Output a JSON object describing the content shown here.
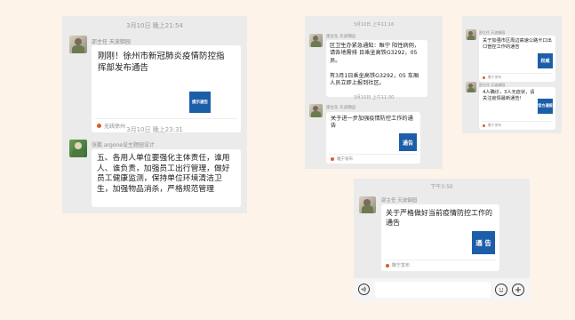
{
  "panel1": {
    "timestamp1": "3月10日 晚上21:54",
    "msg1": {
      "sender": "邵主任 天波御园",
      "text": "刚刚！徐州市新冠肺炎疫情防控指挥部发布通告",
      "thumb_text": "提示通告",
      "source": "无线徐州"
    },
    "timestamp2": "3月10日 晚上23:31",
    "msg2": {
      "sender": "张鹏 argone设主题园设计",
      "text": "五、各用人单位要强化主体责任，谁用人、谁负责，加强员工出行管理，做好员工健康监测，保持单位环境清洁卫生，加强物品消杀，严格规范管理"
    }
  },
  "panel2": {
    "timestamp1": "3月10日 上午11:16",
    "msg1": {
      "sender": "邵主任 天波御园",
      "text1": "区卫生办紧急通知：睢宁 阳性病例，请各地需排 日乘坐高铁G3292，05 员。",
      "text2": "有3月1日乘坐高铁G3292，05 车厢人员立即上报到社区。"
    },
    "timestamp2": "3月10日 上午11:30",
    "msg2": {
      "sender": "邵主任 天波御园",
      "text": "关于进一步加强疫情防控工作的通告",
      "thumb_text": "通告",
      "source": "睢宁发布"
    }
  },
  "panel3": {
    "msg1": {
      "sender": "邵主任 天波御园",
      "text": "关于加强市区周边高速公路卡口出口管控工作的通告",
      "thumb_text": "权威",
      "source": "睢宁发布"
    },
    "msg2": {
      "sender": "邵主任 天波御园",
      "text": "4人确诊，3人无症状，请关注疫情最新通告！",
      "thumb_text": "官方通报",
      "source": "睢宁发布"
    }
  },
  "panel4": {
    "timestamp": "下午3:50",
    "msg": {
      "sender": "邵主任 天波御园",
      "text": "关于严格做好当前疫情防控工作的通告",
      "thumb_text": "通 告",
      "source": "睢宁发布"
    }
  },
  "colors": {
    "background": "#fdf3e8",
    "panel": "#ebebeb",
    "notice_blue": "#1d5ea8",
    "source_dot": "#e05a2a"
  }
}
